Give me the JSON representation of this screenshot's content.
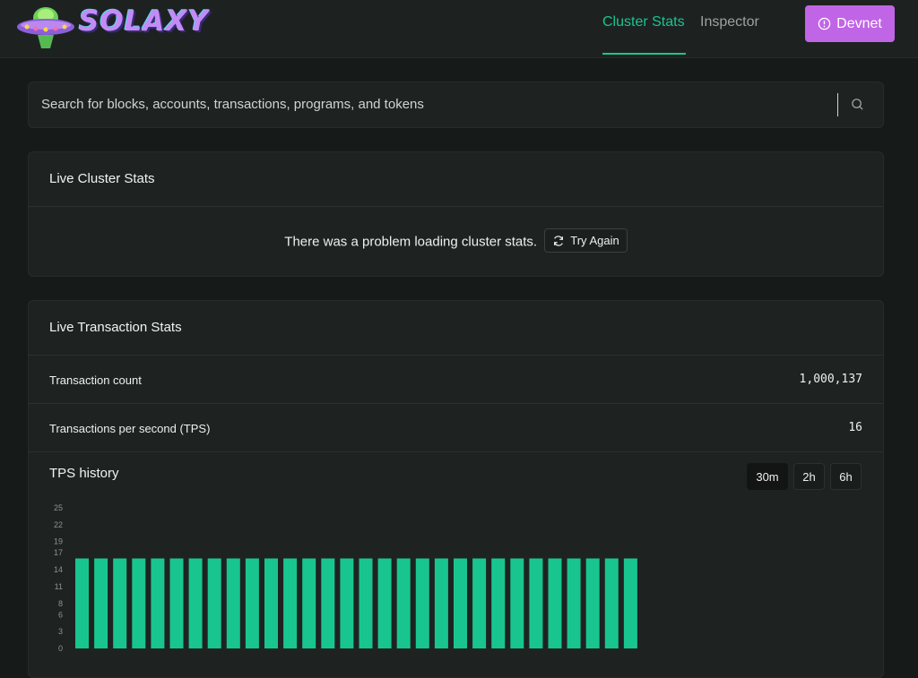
{
  "header": {
    "brand": "SOLAXY",
    "nav": [
      {
        "label": "Cluster Stats",
        "active": true
      },
      {
        "label": "Inspector",
        "active": false
      }
    ],
    "network_button": "Devnet",
    "accent": "#19c58f",
    "button_color": "#c065e6"
  },
  "search": {
    "placeholder": "Search for blocks, accounts, transactions, programs, and tokens"
  },
  "cluster_card": {
    "title": "Live Cluster Stats",
    "error_message": "There was a problem loading cluster stats.",
    "retry_label": "Try Again"
  },
  "tx_card": {
    "title": "Live Transaction Stats",
    "rows": [
      {
        "label": "Transaction count",
        "value": "1,000,137"
      },
      {
        "label": "Transactions per second (TPS)",
        "value": "16"
      }
    ],
    "history_title": "TPS history",
    "ranges": [
      {
        "label": "30m",
        "active": true
      },
      {
        "label": "2h",
        "active": false
      },
      {
        "label": "6h",
        "active": false
      }
    ]
  },
  "chart_data": {
    "type": "bar",
    "title": "",
    "xlabel": "",
    "ylabel": "",
    "y_ticks": [
      "0",
      "3",
      "6",
      "8",
      "11",
      "14",
      "17",
      "19",
      "22",
      "25"
    ],
    "ylim": [
      0,
      25
    ],
    "values": [
      16,
      16,
      16,
      16,
      16,
      16,
      16,
      16,
      16,
      16,
      16,
      16,
      16,
      16,
      16,
      16,
      16,
      16,
      16,
      16,
      16,
      16,
      16,
      16,
      16,
      16,
      16,
      16,
      16,
      16
    ],
    "color": "#19c58f"
  }
}
